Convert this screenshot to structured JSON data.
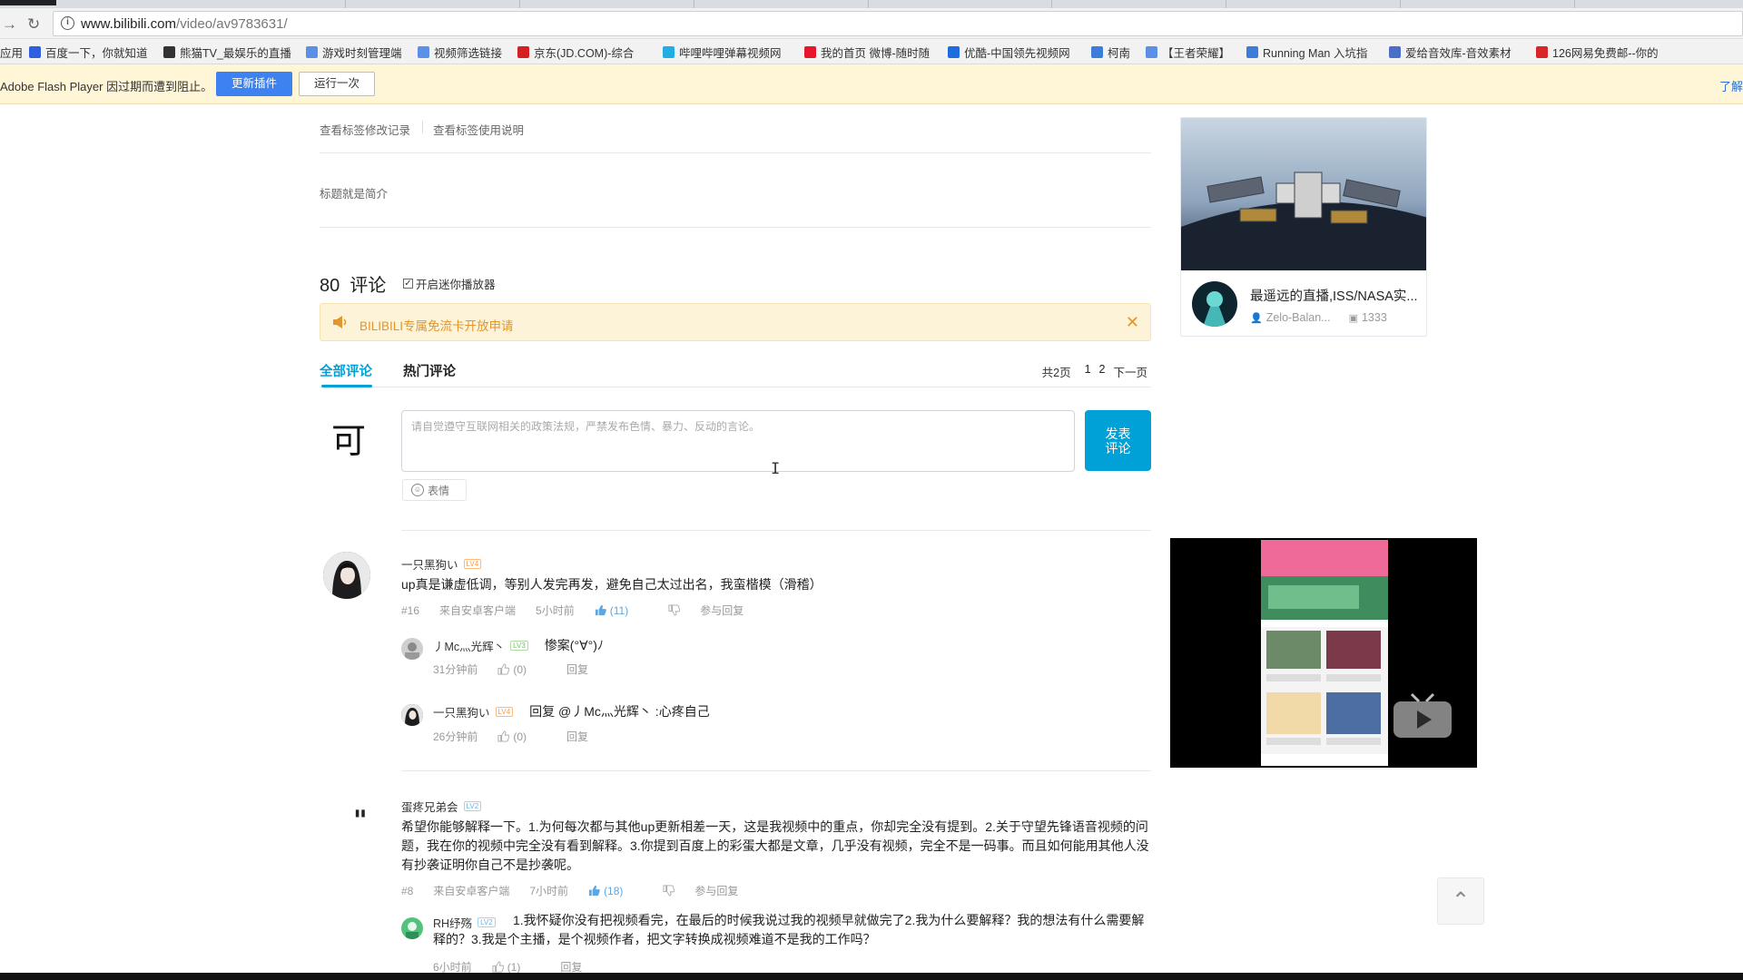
{
  "browser": {
    "url_host": "www.bilibili.com",
    "url_path": "/video/av9783631/",
    "bookmarks": [
      {
        "label": "应用",
        "icon": "apps-icon"
      },
      {
        "label": "百度一下，你就知道",
        "icon": "baidu-icon"
      },
      {
        "label": "熊猫TV_最娱乐的直播",
        "icon": "panda-icon"
      },
      {
        "label": "游戏时刻管理端",
        "icon": "globe-icon"
      },
      {
        "label": "视频筛选链接",
        "icon": "globe-icon"
      },
      {
        "label": "京东(JD.COM)-综合",
        "icon": "jd-icon"
      },
      {
        "label": "哔哩哔哩弹幕视频网",
        "icon": "bilibili-icon"
      },
      {
        "label": "我的首页 微博-随时随",
        "icon": "weibo-icon"
      },
      {
        "label": "优酷-中国领先视频网",
        "icon": "youku-icon"
      },
      {
        "label": "柯南",
        "icon": "bookmark-icon"
      },
      {
        "label": "【王者荣耀】",
        "icon": "globe-icon"
      },
      {
        "label": "Running Man 入坑指",
        "icon": "bookmark-icon"
      },
      {
        "label": "爱给音效库-音效素材",
        "icon": "aigei-icon"
      },
      {
        "label": "126网易免费邮--你的",
        "icon": "mail-icon"
      }
    ]
  },
  "flash_bar": {
    "message": "Adobe Flash Player 因过期而遭到阻止。",
    "update_label": "更新插件",
    "run_once_label": "运行一次",
    "learn_more": "了解"
  },
  "tags": {
    "history_link": "查看标签修改记录",
    "help_link": "查看标签使用说明"
  },
  "description": "标题就是简介",
  "comments_header": {
    "count": "80",
    "label": "评论",
    "mini_player": "开启迷你播放器"
  },
  "notice": {
    "text": "BILIBILI专属免流卡开放申请"
  },
  "comment_tabs": {
    "all": "全部评论",
    "hot": "热门评论",
    "pages_total": "共2页",
    "page1": "1",
    "page2": "2",
    "next": "下一页"
  },
  "composer": {
    "avatar_char": "可",
    "placeholder": "请自觉遵守互联网相关的政策法规，严禁发布色情、暴力、反动的言论。",
    "submit_label": "发表\n评论",
    "emoji_label": "表情"
  },
  "comments": [
    {
      "user": "一只黑狗い",
      "level": "LV4",
      "text": "up真是谦虚低调，等别人发完再发，避免自己太过出名，我蛮楷模（滑稽）",
      "floor": "#16",
      "source": "来自安卓客户端",
      "time": "5小时前",
      "likes": "(11)",
      "reply_label": "参与回复",
      "replies": [
        {
          "user": "丿Mc灬光辉丶",
          "level": "LV3",
          "text": "惨案(°∀°)ﾉ",
          "time": "31分钟前",
          "likes": "(0)",
          "reply_label": "回复"
        },
        {
          "user": "一只黑狗い",
          "level": "LV4",
          "text": "回复 @丿Mc灬光辉丶 :心疼自己",
          "time": "26分钟前",
          "likes": "(0)",
          "reply_label": "回复"
        }
      ]
    },
    {
      "user": "蛋疼兄弟会",
      "level": "LV2",
      "text": "希望你能够解释一下。1.为何每次都与其他up更新相差一天，这是我视频中的重点，你却完全没有提到。2.关于守望先锋语音视频的问题，我在你的视频中完全没有看到解释。3.你提到百度上的彩蛋大都是文章，几乎没有视频，完全不是一码事。而且如何能用其他人没有抄袭证明你自己不是抄袭呢。",
      "floor": "#8",
      "source": "来自安卓客户端",
      "time": "7小时前",
      "likes": "(18)",
      "reply_label": "参与回复",
      "replies": [
        {
          "user": "RH纾殇",
          "level": "LV2",
          "text": "1.我怀疑你没有把视频看完，在最后的时候我说过我的视频早就做完了2.我为什么要解释？我的想法有什么需要解释的？3.我是个主播，是个视频作者，把文字转换成视频难道不是我的工作吗？",
          "time": "6小时前",
          "likes": "(1)",
          "reply_label": "回复"
        }
      ]
    }
  ],
  "sidebar": {
    "rec_title": "最遥远的直播,ISS/NASA实...",
    "rec_up": "Zelo-Balan...",
    "rec_count": "1333"
  },
  "colors": {
    "accent": "#00a1d6",
    "notice_bg": "#fdf3d9",
    "notice_text": "#e0962e",
    "like_blue": "#5aa7e3"
  }
}
